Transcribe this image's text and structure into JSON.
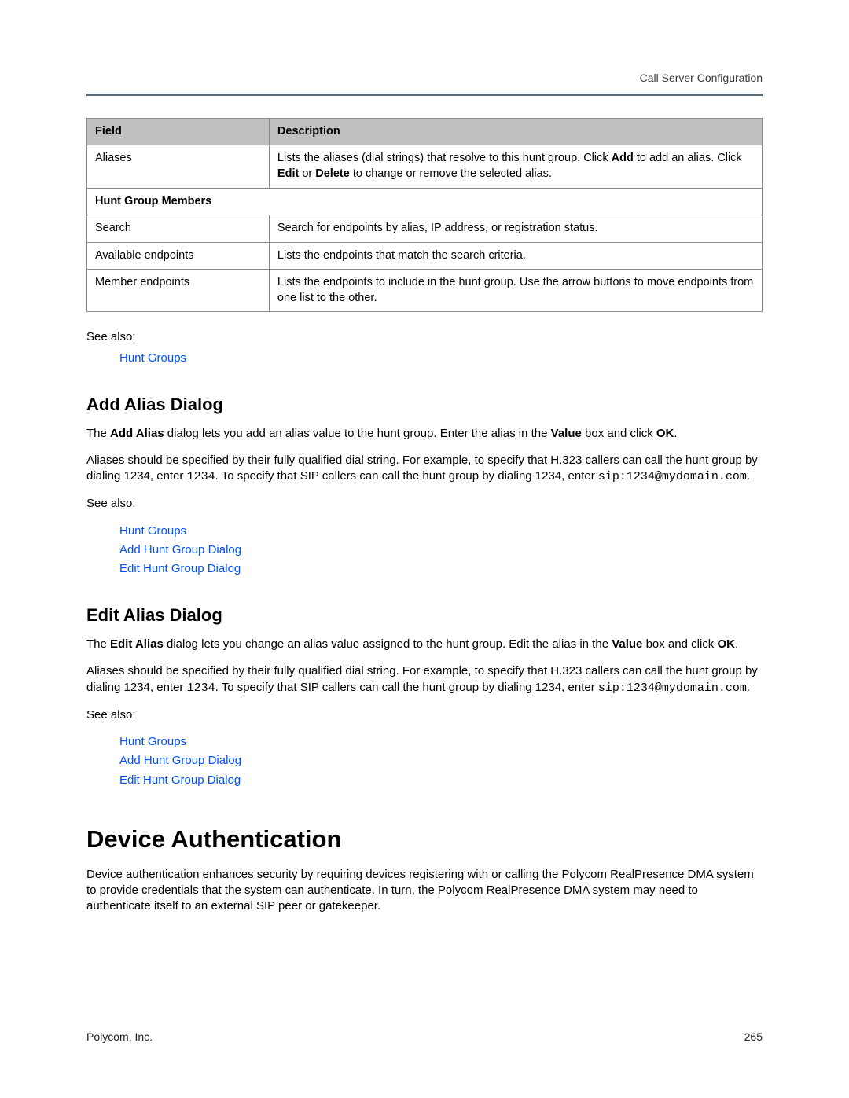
{
  "header": {
    "breadcrumb": "Call Server Configuration"
  },
  "table": {
    "col_field": "Field",
    "col_desc": "Description",
    "row_aliases": {
      "field": "Aliases",
      "desc_1": "Lists the aliases (dial strings) that resolve to this hunt group. Click ",
      "desc_add": "Add",
      "desc_2": " to add an alias. Click ",
      "desc_edit": "Edit",
      "desc_3": " or ",
      "desc_delete": "Delete",
      "desc_4": " to change or remove the selected alias."
    },
    "subhead": "Hunt Group Members",
    "row_search": {
      "field": "Search",
      "desc": "Search for endpoints by alias, IP address, or registration status."
    },
    "row_available": {
      "field": "Available endpoints",
      "desc": "Lists the endpoints that match the search criteria."
    },
    "row_member": {
      "field": "Member endpoints",
      "desc": "Lists the endpoints to include in the hunt group. Use the arrow buttons to move endpoints from one list to the other."
    }
  },
  "see_also_label": "See also:",
  "links": {
    "hunt_groups": "Hunt Groups",
    "add_hunt_group_dialog": "Add Hunt Group Dialog",
    "edit_hunt_group_dialog": "Edit Hunt Group Dialog"
  },
  "add_alias": {
    "heading": "Add Alias Dialog",
    "p1_a": "The ",
    "p1_b": "Add Alias",
    "p1_c": " dialog lets you add an alias value to the hunt group. Enter the alias in the ",
    "p1_d": "Value",
    "p1_e": " box and click ",
    "p1_f": "OK",
    "p1_g": ".",
    "p2_a": "Aliases should be specified by their fully qualified dial string. For example, to specify that H.323 callers can call the hunt group by dialing 1234, enter ",
    "p2_code1": "1234",
    "p2_b": ". To specify that SIP callers can call the hunt group by dialing 1234, enter ",
    "p2_code2": "sip:1234@mydomain.com",
    "p2_c": "."
  },
  "edit_alias": {
    "heading": "Edit Alias Dialog",
    "p1_a": "The ",
    "p1_b": "Edit Alias",
    "p1_c": " dialog lets you change an alias value assigned to the hunt group. Edit the alias in the ",
    "p1_d": "Value",
    "p1_e": " box and click ",
    "p1_f": "OK",
    "p1_g": ".",
    "p2_a": "Aliases should be specified by their fully qualified dial string. For example, to specify that H.323 callers can call the hunt group by dialing 1234, enter ",
    "p2_code1": "1234",
    "p2_b": ". To specify that SIP callers can call the hunt group by dialing 1234, enter ",
    "p2_code2": "sip:1234@mydomain.com",
    "p2_c": "."
  },
  "device_auth": {
    "heading": "Device Authentication",
    "p1": "Device authentication enhances security by requiring devices registering with or calling the Polycom RealPresence DMA system to provide credentials that the system can authenticate. In turn, the Polycom RealPresence DMA system may need to authenticate itself to an external SIP peer or gatekeeper."
  },
  "footer": {
    "left": "Polycom, Inc.",
    "right": "265"
  }
}
